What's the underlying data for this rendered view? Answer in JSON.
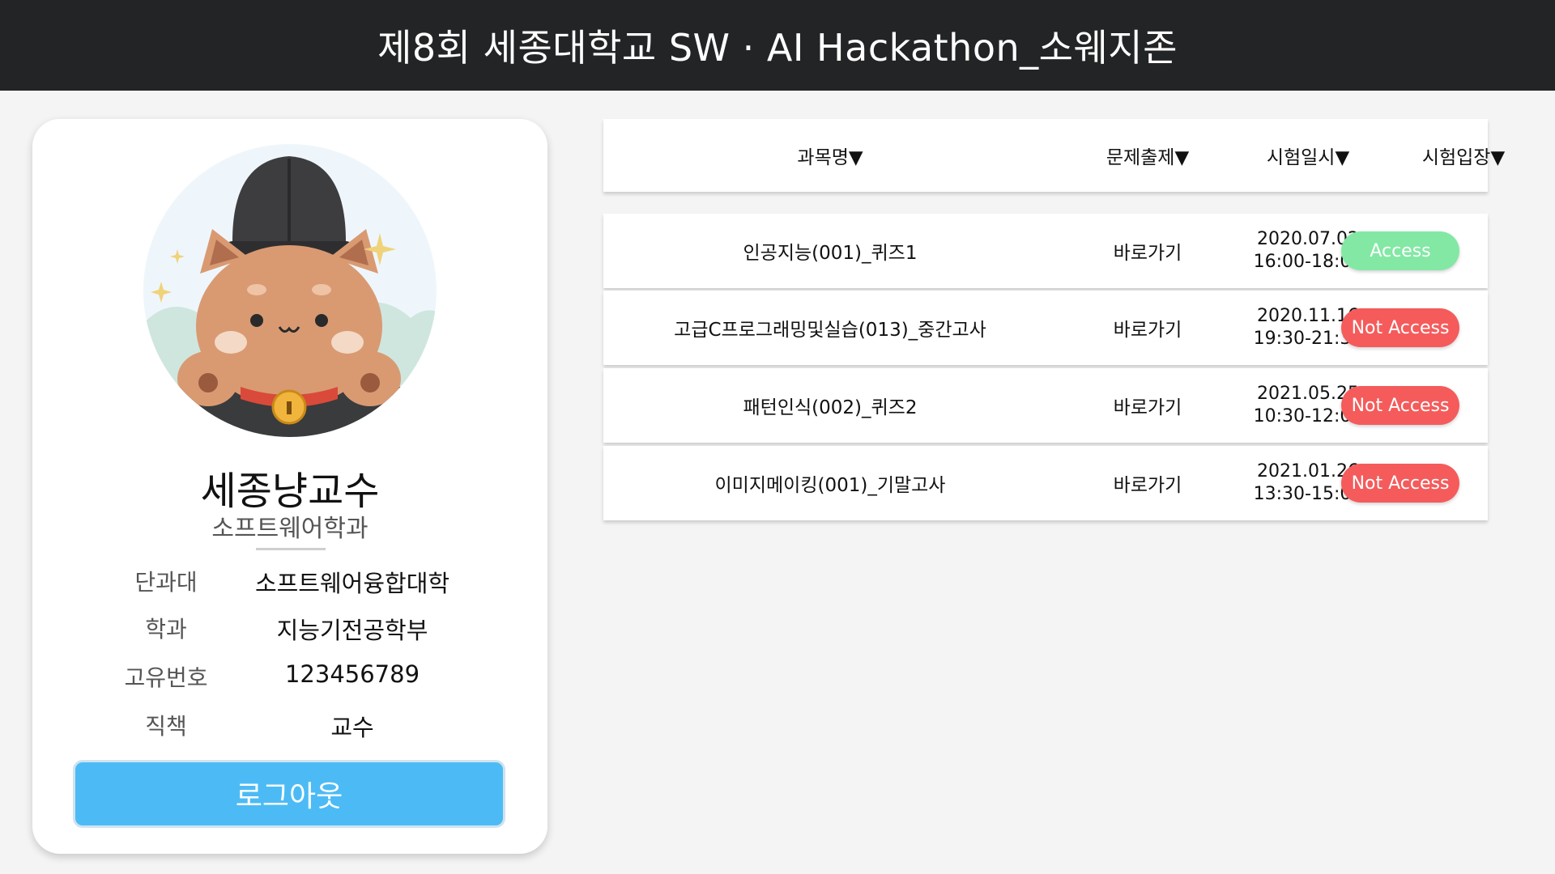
{
  "header": {
    "title": "제8회 세종대학교 SW · AI Hackathon_소웨지존"
  },
  "profile": {
    "avatar_icon": "cat-avatar-icon",
    "name": "세종냥교수",
    "department": "소프트웨어학과",
    "info": [
      {
        "label": "단과대",
        "value": "소프트웨어융합대학"
      },
      {
        "label": "학과",
        "value": "지능기전공학부"
      },
      {
        "label": "고유번호",
        "value": "123456789"
      },
      {
        "label": "직책",
        "value": "교수"
      }
    ],
    "logout_label": "로그아웃"
  },
  "table": {
    "headers": [
      "과목명▼",
      "문제출제▼",
      "시험일시▼",
      "시험입장▼"
    ],
    "rows": [
      {
        "subject": "인공지능(001)_퀴즈1",
        "action": "바로가기",
        "date": "2020.07.02",
        "time": "16:00-18:00",
        "status": "Access",
        "status_color": "#83e8a4"
      },
      {
        "subject": "고급C프로그래밍및실습(013)_중간고사",
        "action": "바로가기",
        "date": "2020.11.16",
        "time": "19:30-21:30",
        "status": "Not Access",
        "status_color": "#f55b5b"
      },
      {
        "subject": "패턴인식(002)_퀴즈2",
        "action": "바로가기",
        "date": "2021.05.25",
        "time": "10:30-12:00",
        "status": "Not Access",
        "status_color": "#f55b5b"
      },
      {
        "subject": "이미지메이킹(001)_기말고사",
        "action": "바로가기",
        "date": "2021.01.26",
        "time": "13:30-15:00",
        "status": "Not Access",
        "status_color": "#f55b5b"
      }
    ]
  },
  "colors": {
    "header_bg": "#232426",
    "logout_bg": "#4cbbf5",
    "access": "#83e8a4",
    "not_access": "#f55b5b"
  }
}
